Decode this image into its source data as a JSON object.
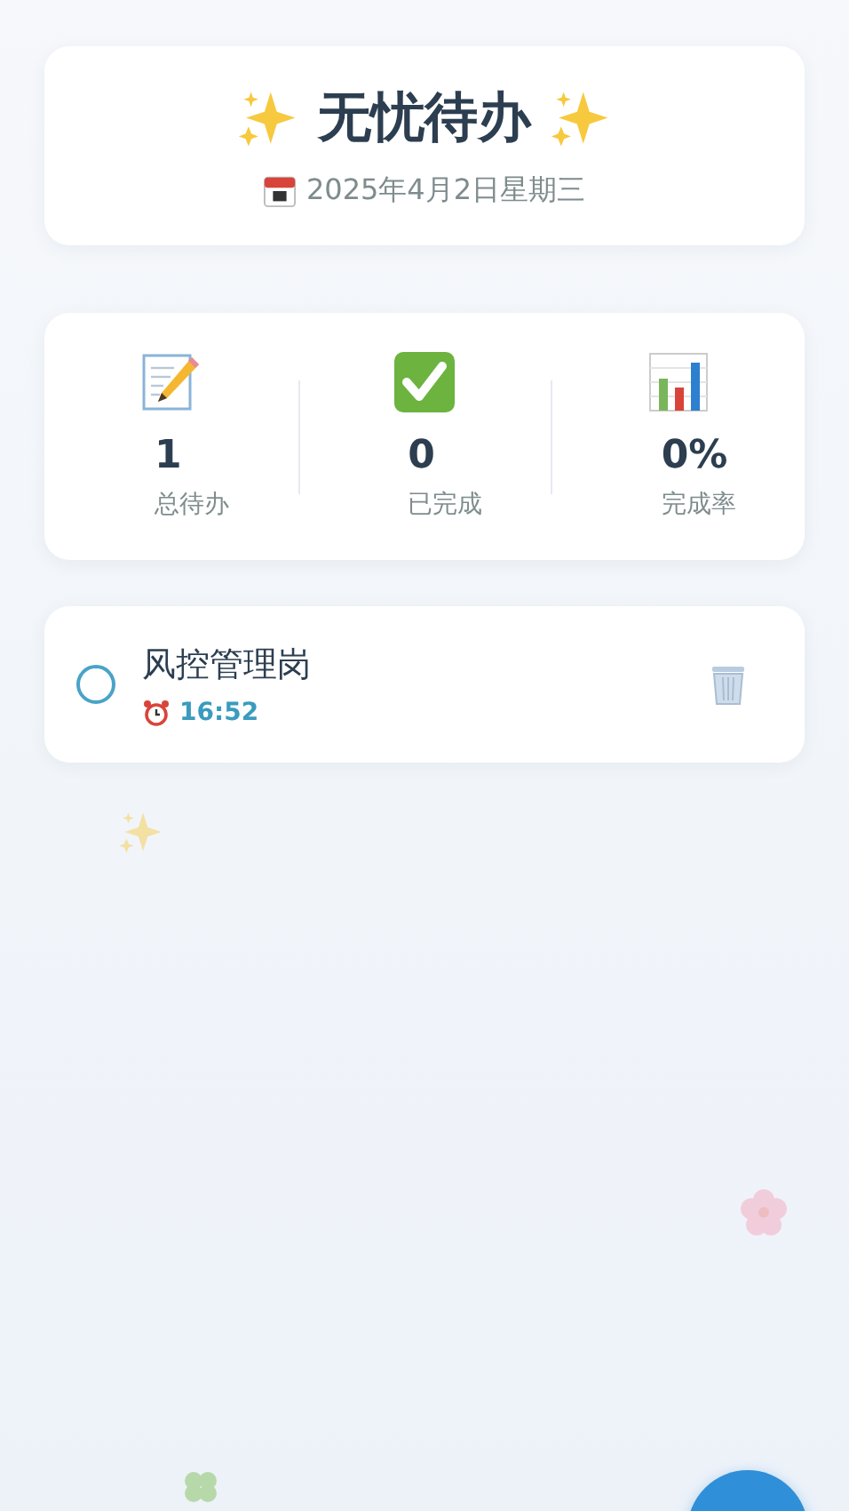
{
  "header": {
    "title": "无忧待办",
    "date": "2025年4月2日星期三"
  },
  "stats": [
    {
      "value": "1",
      "label": "总待办"
    },
    {
      "value": "0",
      "label": "已完成"
    },
    {
      "value": "0%",
      "label": "完成率"
    }
  ],
  "tasks": [
    {
      "title": "风控管理岗",
      "time": "16:52",
      "completed": false
    }
  ]
}
